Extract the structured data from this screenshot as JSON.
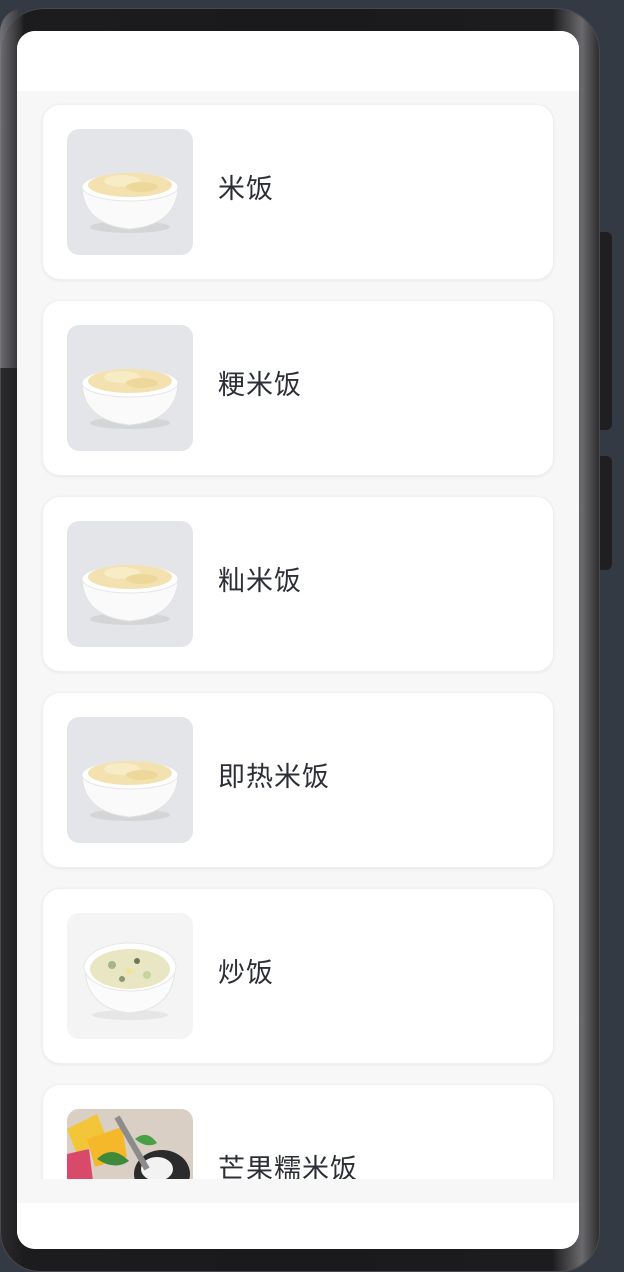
{
  "food_list": {
    "items": [
      {
        "label": "米饭",
        "image": "rice-bowl-image"
      },
      {
        "label": "粳米饭",
        "image": "rice-bowl-image"
      },
      {
        "label": "籼米饭",
        "image": "rice-bowl-image"
      },
      {
        "label": "即热米饭",
        "image": "rice-bowl-image"
      },
      {
        "label": "炒饭",
        "image": "fried-rice-image"
      },
      {
        "label": "芒果糯米饭",
        "image": "mango-sticky-rice-image"
      }
    ]
  },
  "colors": {
    "background": "#f7f7f7",
    "card": "#ffffff",
    "text": "#2c2f36",
    "device_frame": "#1a1a1c"
  }
}
